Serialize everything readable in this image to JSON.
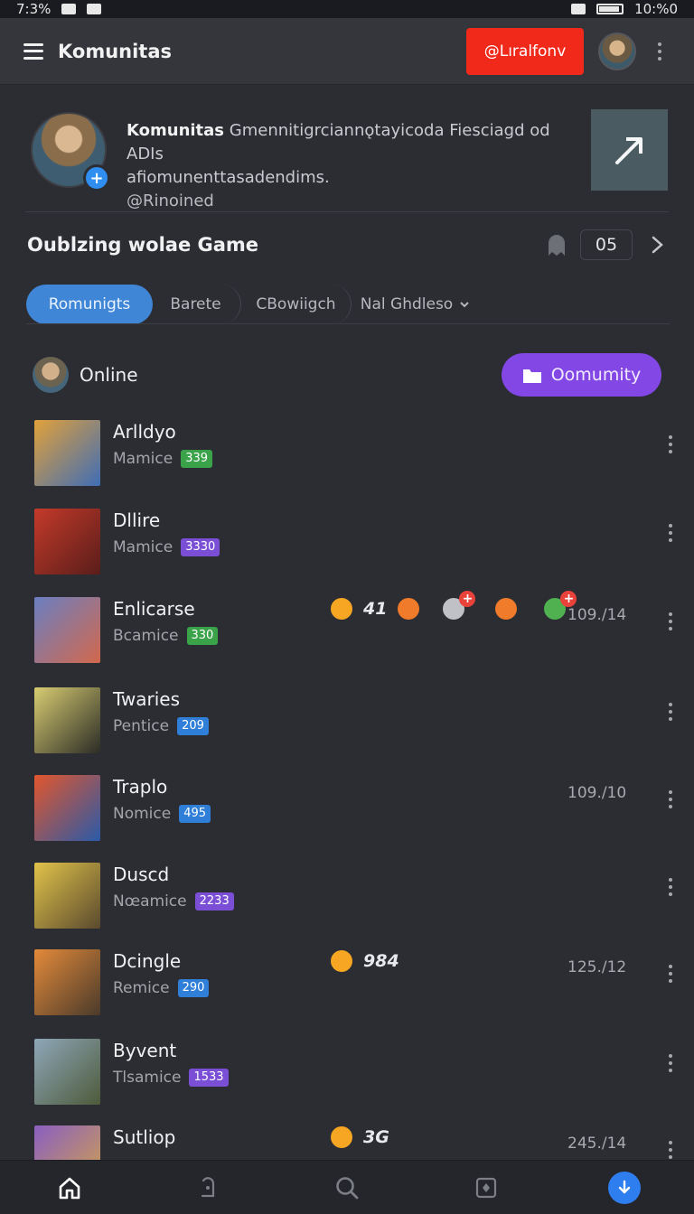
{
  "status_bar": {
    "time_left": "7:3%",
    "time_right": "10:%0"
  },
  "app_bar": {
    "title": "Komunitas",
    "user_chip": "@Lıralfonv"
  },
  "profile": {
    "name": "Komunitas",
    "description": "Gmennitigrciannǫtayicoda Fiesciagd od ADIs",
    "description_2": "afiomunenttasadendims.",
    "handle": "@Rinoined"
  },
  "section": {
    "title": "Oublzing wolae Game",
    "count": "05"
  },
  "tabs": [
    {
      "label": "Romunigts"
    },
    {
      "label": "Barete"
    },
    {
      "label": "CBowiigch"
    },
    {
      "label": "Nal Ghdleso"
    }
  ],
  "online": {
    "label": "Online",
    "community_button": "Oomumity"
  },
  "items": [
    {
      "name": "Arlldyo",
      "sub": "Mamice",
      "badge": "339",
      "badge_color": "green",
      "time": ""
    },
    {
      "name": "Dllire",
      "sub": "Mamice",
      "badge": "3330",
      "badge_color": "purple",
      "time": ""
    },
    {
      "name": "Enlicarse",
      "sub": "Bcamice",
      "badge": "330",
      "badge_color": "green",
      "time": "109./14",
      "reaction_count": "41"
    },
    {
      "name": "Twaries",
      "sub": "Pentice",
      "badge": "209",
      "badge_color": "blue",
      "time": ""
    },
    {
      "name": "Traplo",
      "sub": "Nomice",
      "badge": "495",
      "badge_color": "blue",
      "time": "109./10"
    },
    {
      "name": "Duscd",
      "sub": "Nœamice",
      "badge": "2233",
      "badge_color": "purple",
      "time": ""
    },
    {
      "name": "Dcingle",
      "sub": "Remice",
      "badge": "290",
      "badge_color": "blue",
      "time": "125./12",
      "reaction_count": "984"
    },
    {
      "name": "Byvent",
      "sub": "Tlsamice",
      "badge": "1533",
      "badge_color": "purple",
      "time": ""
    },
    {
      "name": "Sutliop",
      "sub": "",
      "badge": "",
      "badge_color": "purple",
      "time": "245./14",
      "reaction_count": "3G"
    }
  ],
  "thumb_colors": [
    [
      "#e2a13a",
      "#3f6db5"
    ],
    [
      "#c33a2a",
      "#5a1d1a"
    ],
    [
      "#6a7fc2",
      "#d2684c"
    ],
    [
      "#d8cc72",
      "#2b2c26"
    ],
    [
      "#e2562c",
      "#2a5aa8"
    ],
    [
      "#e1c24a",
      "#5a4a2e"
    ],
    [
      "#e38a3a",
      "#4a3a2a"
    ],
    [
      "#8fa7b9",
      "#4d5a3a"
    ],
    [
      "#8a5fc2",
      "#d2a24a"
    ]
  ]
}
